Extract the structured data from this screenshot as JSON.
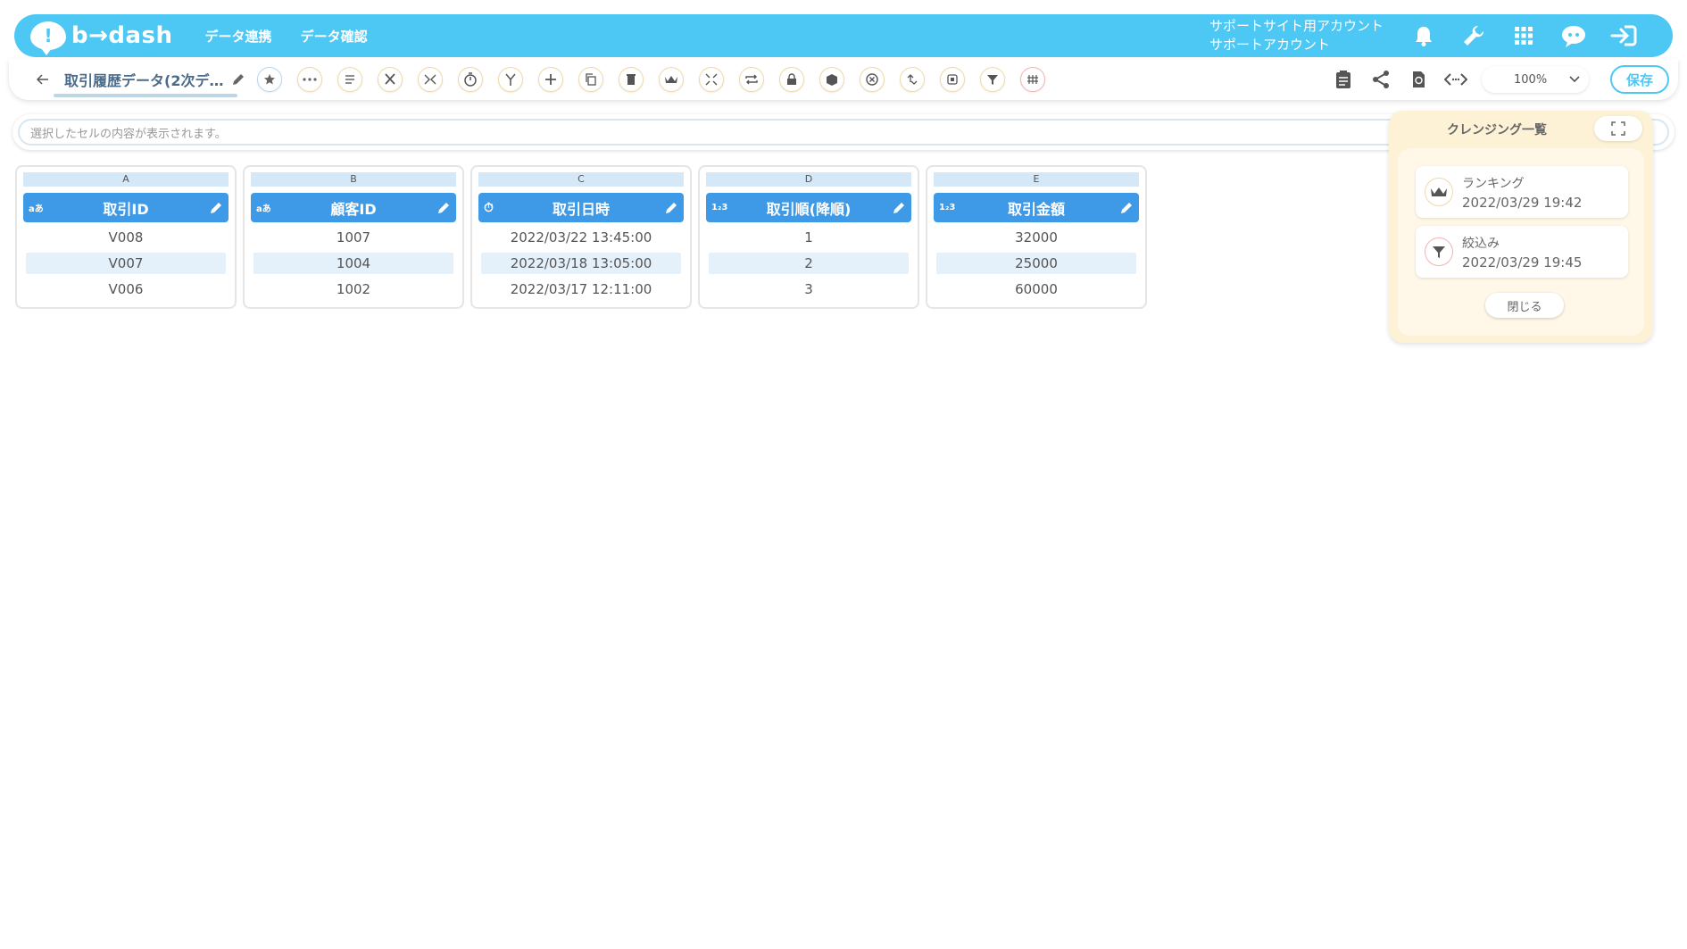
{
  "header": {
    "logo_text": "b→dash",
    "nav": [
      "データ連携",
      "データ確認"
    ],
    "account_line1": "サポートサイト用アカウント",
    "account_line2": "サポートアカウント",
    "icons": [
      "bell-icon",
      "wrench-icon",
      "grid-icon",
      "chat-icon",
      "logout-icon"
    ],
    "accent": "#4dc8f5"
  },
  "toolbar": {
    "title": "取引履歴データ(2次デ…",
    "zoom": "100%",
    "save_label": "保存"
  },
  "cellbar": {
    "placeholder": "選択したセルの内容が表示されます。"
  },
  "columns": [
    {
      "letter": "A",
      "type": "aあ",
      "name": "取引ID",
      "cells": [
        "V008",
        "V007",
        "V006"
      ]
    },
    {
      "letter": "B",
      "type": "aあ",
      "name": "顧客ID",
      "cells": [
        "1007",
        "1004",
        "1002"
      ]
    },
    {
      "letter": "C",
      "type": "⏱",
      "name": "取引日時",
      "cells": [
        "2022/03/22 13:45:00",
        "2022/03/18 13:05:00",
        "2022/03/17 12:11:00"
      ]
    },
    {
      "letter": "D",
      "type": "1₂3",
      "name": "取引順(降順)",
      "cells": [
        "1",
        "2",
        "3"
      ]
    },
    {
      "letter": "E",
      "type": "1₂3",
      "name": "取引金額",
      "cells": [
        "32000",
        "25000",
        "60000"
      ]
    }
  ],
  "panel": {
    "title": "クレンジング一覧",
    "items": [
      {
        "name": "ランキング",
        "time": "2022/03/29 19:42",
        "icon": "crown-icon"
      },
      {
        "name": "絞込み",
        "time": "2022/03/29 19:45",
        "icon": "filter-icon"
      }
    ],
    "close_label": "閉じる"
  }
}
